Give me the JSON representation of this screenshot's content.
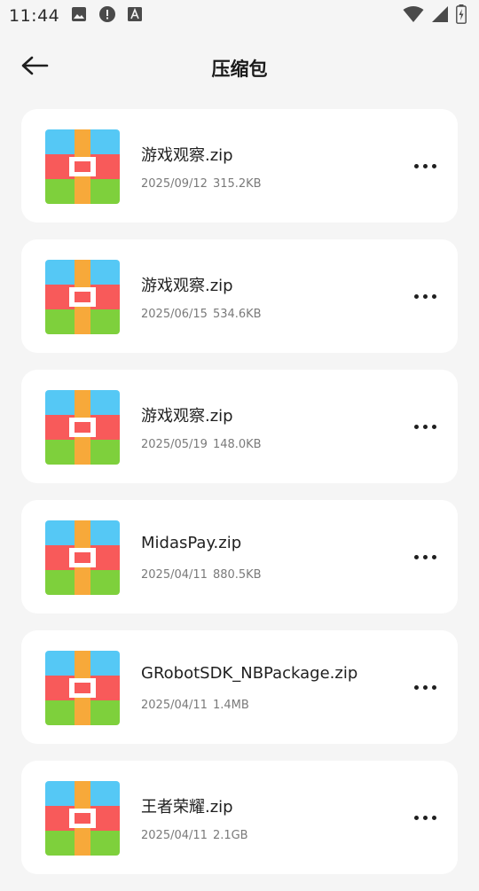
{
  "status_bar": {
    "time": "11:44",
    "left_icons": [
      "image-icon",
      "alert-icon",
      "font-icon"
    ],
    "right_icons": [
      "wifi-icon",
      "signal-icon",
      "battery-icon"
    ]
  },
  "header": {
    "title": "压缩包",
    "back_icon": "arrow-left-icon"
  },
  "files": [
    {
      "name": "游戏观察.zip",
      "date": "2025/09/12",
      "size": "315.2KB"
    },
    {
      "name": "游戏观察.zip",
      "date": "2025/06/15",
      "size": "534.6KB"
    },
    {
      "name": "游戏观察.zip",
      "date": "2025/05/19",
      "size": "148.0KB"
    },
    {
      "name": "MidasPay.zip",
      "date": "2025/04/11",
      "size": "880.5KB"
    },
    {
      "name": "GRobotSDK_NBPackage.zip",
      "date": "2025/04/11",
      "size": "1.4MB"
    },
    {
      "name": "王者荣耀.zip",
      "date": "2025/04/11",
      "size": "2.1GB"
    }
  ],
  "colors": {
    "background": "#f5f5f5",
    "card": "#ffffff",
    "zip_top": "#55c8f5",
    "zip_middle": "#f85a5a",
    "zip_bottom": "#7ed03c",
    "zip_strap": "#f7a93a"
  }
}
